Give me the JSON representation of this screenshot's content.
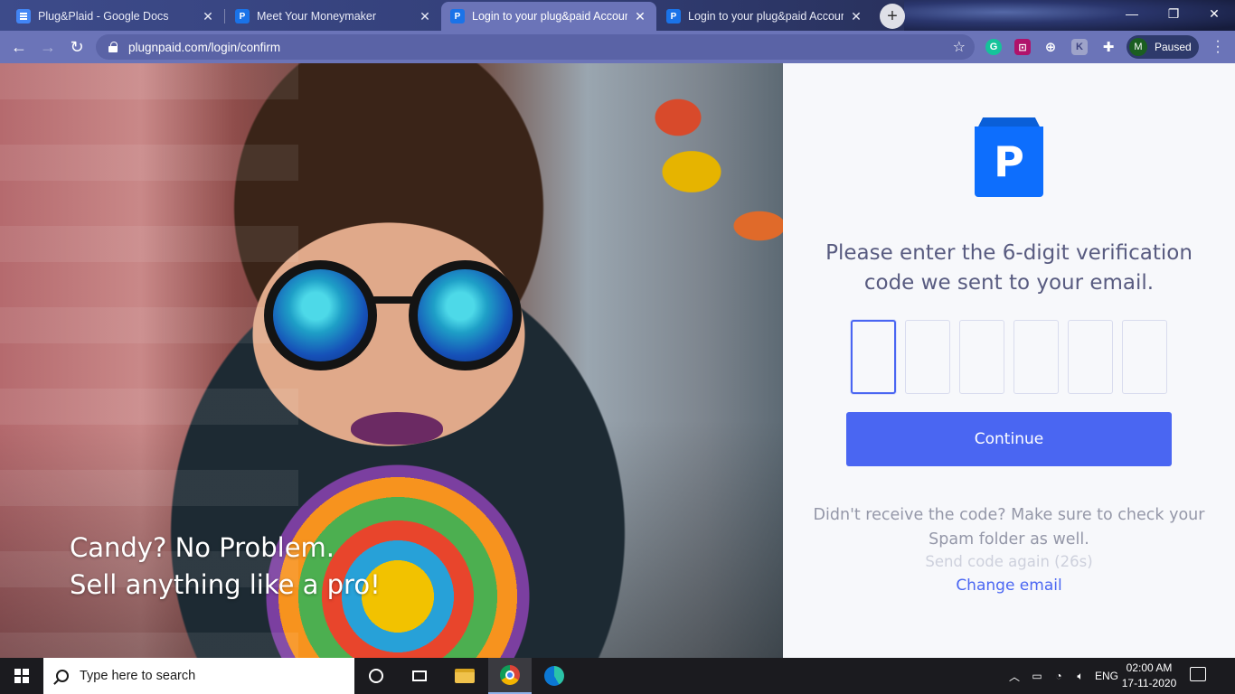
{
  "browser": {
    "tabs": [
      {
        "title": "Plug&Plaid - Google Docs",
        "favicon": "google-docs-icon",
        "active": false
      },
      {
        "title": "Meet Your Moneymaker",
        "favicon": "plugnpaid-icon",
        "active": false
      },
      {
        "title": "Login to your plug&paid Accoun",
        "favicon": "plugnpaid-icon",
        "active": true
      },
      {
        "title": "Login to your plug&paid Accoun",
        "favicon": "plugnpaid-icon",
        "active": false
      }
    ],
    "url": "plugnpaid.com/login/confirm",
    "profile_initial": "M",
    "profile_status": "Paused",
    "colors": {
      "frame": "#6b74b8",
      "omnibox": "#5a63a6"
    }
  },
  "hero": {
    "caption_line1": "Candy? No Problem.",
    "caption_line2": "Sell anything like a pro!"
  },
  "login": {
    "logo_letter": "P",
    "prompt": "Please enter the 6-digit verification code we sent to your email.",
    "code_digits": [
      "",
      "",
      "",
      "",
      "",
      ""
    ],
    "continue_label": "Continue",
    "help_text": "Didn't receive the code? Make sure to check your Spam folder as well.",
    "resend_text": "Send code again (26s)",
    "change_email": "Change email",
    "colors": {
      "accent": "#4a66f2",
      "logo": "#0d6efd",
      "prompt": "#585b80"
    }
  },
  "taskbar": {
    "search_placeholder": "Type here to search",
    "language": "ENG",
    "time": "02:00 AM",
    "date": "17-11-2020"
  }
}
